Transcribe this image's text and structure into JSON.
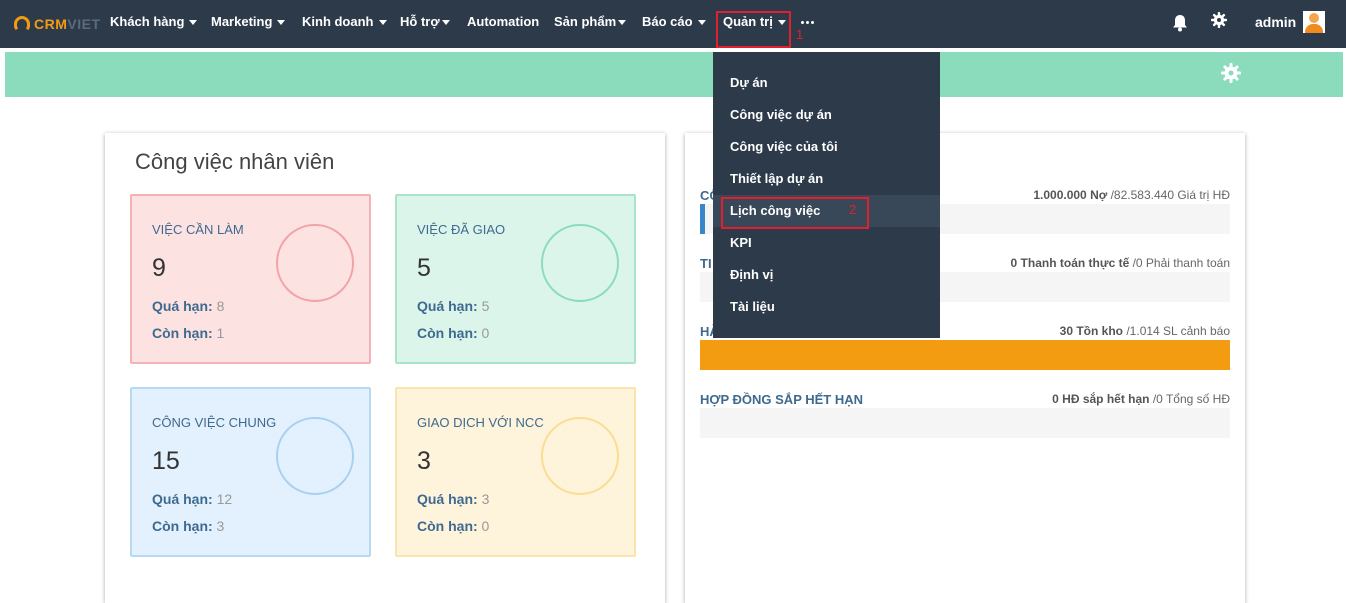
{
  "nav": {
    "logo_crm": "CRM",
    "logo_viet": "VIET",
    "items": [
      {
        "label": "Khách hàng"
      },
      {
        "label": "Marketing"
      },
      {
        "label": "Kinh doanh"
      },
      {
        "label": "Hỗ trợ"
      },
      {
        "label": "Automation"
      },
      {
        "label": "Sản phẩm"
      },
      {
        "label": "Báo cáo"
      },
      {
        "label": "Quản trị"
      }
    ],
    "more_icon": "ellipsis-icon",
    "bell_icon": "bell-icon",
    "settings_icon": "gear-icon",
    "user": "admin"
  },
  "annotations": {
    "step1": "1",
    "step2": "2",
    "color": "#e2202d"
  },
  "dropdown": {
    "items": [
      {
        "label": "Dự án"
      },
      {
        "label": "Công việc dự án"
      },
      {
        "label": "Công việc của tôi"
      },
      {
        "label": "Thiết lập dự án"
      },
      {
        "label": "Lịch công việc"
      },
      {
        "label": "KPI"
      },
      {
        "label": "Định vị"
      },
      {
        "label": "Tài liệu"
      }
    ]
  },
  "left_panel": {
    "title": "Công việc nhân viên",
    "overdue_label": "Quá hạn:",
    "remaining_label": "Còn hạn:",
    "cards": [
      {
        "title": "VIỆC CẦN LÀM",
        "count": "9",
        "overdue": "8",
        "remaining": "1"
      },
      {
        "title": "VIỆC ĐÃ GIAO",
        "count": "5",
        "overdue": "5",
        "remaining": "0"
      },
      {
        "title": "CÔNG VIỆC CHUNG",
        "count": "15",
        "overdue": "12",
        "remaining": "3"
      },
      {
        "title": "GIAO DỊCH VỚI NCC",
        "count": "3",
        "overdue": "3",
        "remaining": "0"
      }
    ]
  },
  "right_panel": {
    "rows": [
      {
        "label": "CÔ",
        "value_bold": "1.000.000 Nợ",
        "value_rest": " /82.583.440 Giá trị HĐ",
        "fill_fraction": 0.01,
        "fill_color": "#3a86c8"
      },
      {
        "label": "TI",
        "value_bold": "0 Thanh toán thực tế",
        "value_rest": " /0 Phải thanh toán",
        "fill_fraction": 0,
        "fill_color": "#3a86c8"
      },
      {
        "label": "HÀ",
        "value_bold": "30 Tồn kho",
        "value_rest": " /1.014 SL cảnh báo",
        "fill_fraction": 1,
        "fill_color": "#f39c12"
      },
      {
        "label": "HỢP ĐỒNG SẮP HẾT HẠN",
        "value_bold": "0 HĐ sắp hết hạn",
        "value_rest": " /0 Tổng số HĐ",
        "fill_fraction": 0,
        "fill_color": "#3a86c8"
      }
    ]
  }
}
